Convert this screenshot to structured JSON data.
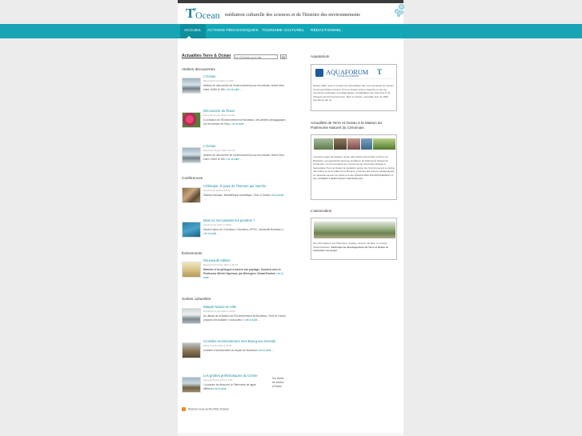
{
  "header": {
    "logo_re": "re",
    "logo_t": "T",
    "logo_ocean": "Ocean",
    "tagline": "médiation culturelle des sciences  et  de  l'histoire  des  environnements"
  },
  "nav": {
    "items": [
      {
        "label": "ACCUEIL"
      },
      {
        "label": "ACTIONS PÉDAGOGIQUES"
      },
      {
        "label": "TOURISME CULTUREL"
      },
      {
        "label": "RÉDACTIONNEL"
      }
    ]
  },
  "main": {
    "title": "Actualités Terre & Océan",
    "search_placeholder": "ex. Chercher sur le site",
    "search_button": "OK",
    "sections": [
      {
        "heading": "Ateliers découvertes",
        "entries": [
          {
            "title": "L'Océan",
            "date": "Mercredi 8 juin 2011 à 14:00",
            "text": "Ateliers de découverte de l'environnement pour les enfants, entrée libre, entre 14h00 et 18h.",
            "more": "Lire la suite →"
          },
          {
            "title": "Découverte du fleuve",
            "date": "Mercredi 11 juin 2011 à 14:00",
            "text": "À la Maison de l'Environnement de Bordeaux, des ateliers pédagogiques sur les thèmes de l'eau.",
            "more": "Lire la suite →"
          },
          {
            "title": "L'Océan",
            "date": "Mercredi 15 juin 2011 à 14:00",
            "text": "Ateliers de découverte de l'environnement pour les enfants, entrée libre, entre 14h00 et 18h.",
            "more": "Lire la suite →"
          }
        ]
      },
      {
        "heading": "Conférences",
        "entries": [
          {
            "title": "L'Éthiopie, le pays de l'homme qui marche",
            "date": "Jeudi 9 juin 2011 à 18:00",
            "text": "Salinas Noceyau, Médiathèque scientifique, Terre & Océan",
            "more": "Lire la suite →"
          },
          {
            "title": "Mais où sont passés les poudres ?",
            "date": "Jeudi 16 juin 2011 à 18:00",
            "text": "Sarah Dureux du Créonsiau, Créonlieux, EPOC, Université Bordeaux 1",
            "more": "Lire la suite →"
          }
        ]
      },
      {
        "heading": "Événements",
        "entries": [
          {
            "title": "Nouveauté édition",
            "date": "Mercredi 22 février 2011 à 18:37",
            "text": "Mémoire d'un géologue à travers son paysage. Causerie avec le Professeur Michel Vigneaux, par Bérengère Chazal-Pautron",
            "more": "Lire la suite →"
          }
        ]
      },
      {
        "heading": "Sorties culturelles",
        "entries": [
          {
            "title": "Balade Nature en ville",
            "date": "Dimanche 5 juin 2011 à 14:00",
            "text": "Au départ de la Maison de l'Environnement de Bordeaux, Terre et Océan propose des balades « tout public »",
            "more": "Lire la suite →"
          },
          {
            "title": "Croisière environnement vers Bourg-sur-Gironde",
            "date": "Mardi 14 juin 2011 à 14:00",
            "text": "croisière environnement au départ de Bordeaux",
            "more": "Lire la suite →"
          },
          {
            "title": "Les grottes préhistoriques du Centre",
            "date": "Samedi 18 juin 2011 à 7:00",
            "text": "L'occasion de découvrir le Patrimoine de lagon différent",
            "more": "Lire la suite →",
            "aside": "Sur toutes les sorties d'Océan"
          }
        ]
      }
    ],
    "rss_label": "Abonnez-vous au flux RSS d'Océan"
  },
  "sidebar": {
    "aquatorium": {
      "heading": "Aquatorium",
      "logo_word": "AQUAFORUM",
      "logo_sub": "NOUVELLES SCIENCES",
      "text": "Depuis 2001, avec le soutien de l'Association des Communautés du Canton Communal Plaine d'Aunis, Terre et Océan anime l'Aquaforum, lieu de rencontres culturelles et pédagogiques, de Médiation des Sciences et de l'Histoire des Environnements. Terre et Océan y accueille plus de 4000 personnes par an."
    },
    "maison": {
      "heading": "Actualités de Terre et Océan à la Maison du Patrimoine Naturel du Créonnais",
      "text": "L'ancienne gare de Sadirac, située dans l'Entre-deux-Mers à 20 km de Bordeaux, est aujourd'hui devenue la Maison du Patrimoine Naturel du Créonnais. La Communauté de Communes du Créonnais délègue à l'association Terre et Océan la médiation autour de l'environnement en Entre-deux-Mers et de la vallée de la Pimpine, à travers des actions pédagogiques et culturelles auprès du public lors des DIMANCHES ENVIRONNEMENT et des SOIRÉES THÉMATIQUES MENSUELLES."
    },
    "association": {
      "heading": "L'association",
      "text": "Des informations sur l'historique, l'équipe, devenir membre, le conseil d'administration.",
      "bold": "Participez au développement de Terre et Océan en soutenant son projet."
    }
  },
  "colors": {
    "nav": "#11a7b7",
    "link": "#1b8fa1",
    "brand": "#1d7f96"
  }
}
